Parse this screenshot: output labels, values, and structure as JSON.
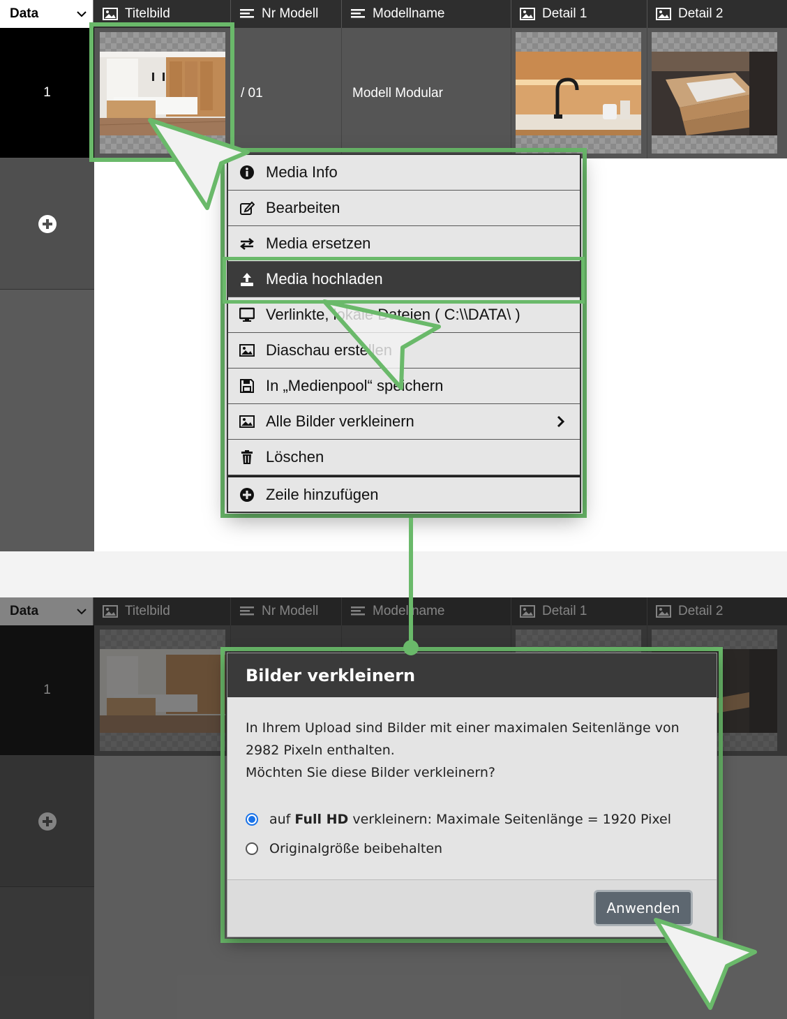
{
  "top_grid": {
    "data_select": "Data",
    "columns": [
      {
        "label": "Titelbild",
        "icon": "image-icon"
      },
      {
        "label": "Nr Modell",
        "icon": "text-lines-icon"
      },
      {
        "label": "Modellname",
        "icon": "text-lines-icon"
      },
      {
        "label": "Detail 1",
        "icon": "image-icon"
      },
      {
        "label": "Detail 2",
        "icon": "image-icon"
      }
    ],
    "row": {
      "number": "1",
      "nr_modell": "/ 01",
      "modellname": "Modell Modular"
    }
  },
  "context_menu": {
    "items": [
      {
        "label": "Media Info",
        "icon": "info-circle-icon"
      },
      {
        "label": "Bearbeiten",
        "icon": "edit-icon"
      },
      {
        "label": "Media ersetzen",
        "icon": "swap-arrows-icon"
      },
      {
        "label": "Media hochladen",
        "icon": "upload-icon",
        "active": true
      },
      {
        "label": "Verlinkte, lokale Dateien ( C:\\\\DATA\\ )",
        "icon": "monitor-icon"
      },
      {
        "label": "Diaschau erstellen",
        "icon": "image-icon"
      },
      {
        "label": "In „Medienpool“ speichern",
        "icon": "save-icon"
      },
      {
        "label": "Alle Bilder verkleinern",
        "icon": "image-icon",
        "submenu": true
      },
      {
        "label": "Löschen",
        "icon": "trash-icon"
      },
      {
        "label": "Zeile hinzufügen",
        "icon": "plus-circle-icon"
      }
    ]
  },
  "bottom_grid": {
    "data_select": "Data",
    "columns": [
      {
        "label": "Titelbild"
      },
      {
        "label": "Nr Modell"
      },
      {
        "label": "Modellname"
      },
      {
        "label": "Detail 1"
      },
      {
        "label": "Detail 2"
      }
    ],
    "row": {
      "number": "1"
    }
  },
  "dialog": {
    "title": "Bilder verkleinern",
    "message_line1": "In Ihrem Upload sind Bilder mit einer maximalen Seitenlänge von",
    "message_line2": "2982 Pixeln enthalten.",
    "message_line3": "Möchten Sie diese Bilder verkleinern?",
    "option1_prefix": "auf ",
    "option1_bold": "Full HD",
    "option1_suffix": " verkleinern: Maximale Seitenlänge = 1920 Pixel",
    "option2": "Originalgröße beibehalten",
    "apply_button": "Anwenden"
  },
  "colors": {
    "highlight": "#6ab96a",
    "header_bg": "#2e2e2e",
    "active_menu": "#3b3b3b",
    "radio_selected": "#1a73e8",
    "button": "#5d6770"
  }
}
